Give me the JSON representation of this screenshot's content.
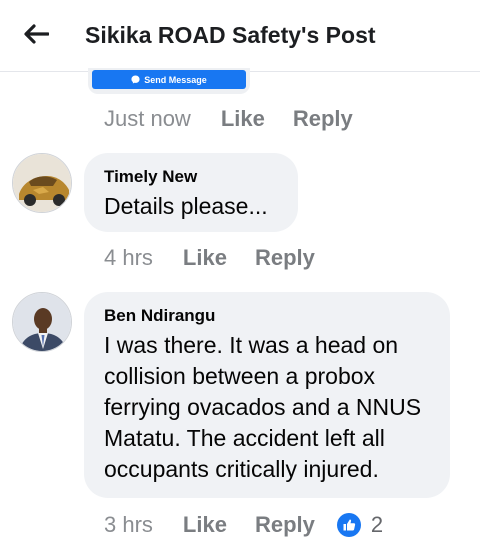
{
  "header": {
    "title": "Sikika ROAD Safety's Post"
  },
  "prev_comment": {
    "send_message_label": "Send Message",
    "time": "Just now",
    "like_label": "Like",
    "reply_label": "Reply"
  },
  "comments": [
    {
      "author": "Timely New",
      "text": "Details please...",
      "time": "4 hrs",
      "like_label": "Like",
      "reply_label": "Reply"
    },
    {
      "author": "Ben Ndirangu",
      "text": "I was there. It was a head on collision between a probox ferrying ovacados and a NNUS Matatu. The accident left all occupants critically injured.",
      "time": "3 hrs",
      "like_label": "Like",
      "reply_label": "Reply",
      "reaction_count": "2"
    }
  ],
  "colors": {
    "accent": "#1877f2",
    "bubble": "#f0f2f5",
    "meta_text": "#8a8d91"
  },
  "icons": {
    "back": "arrow-left-icon",
    "messenger": "messenger-icon",
    "like_reaction": "thumbs-up-icon"
  }
}
